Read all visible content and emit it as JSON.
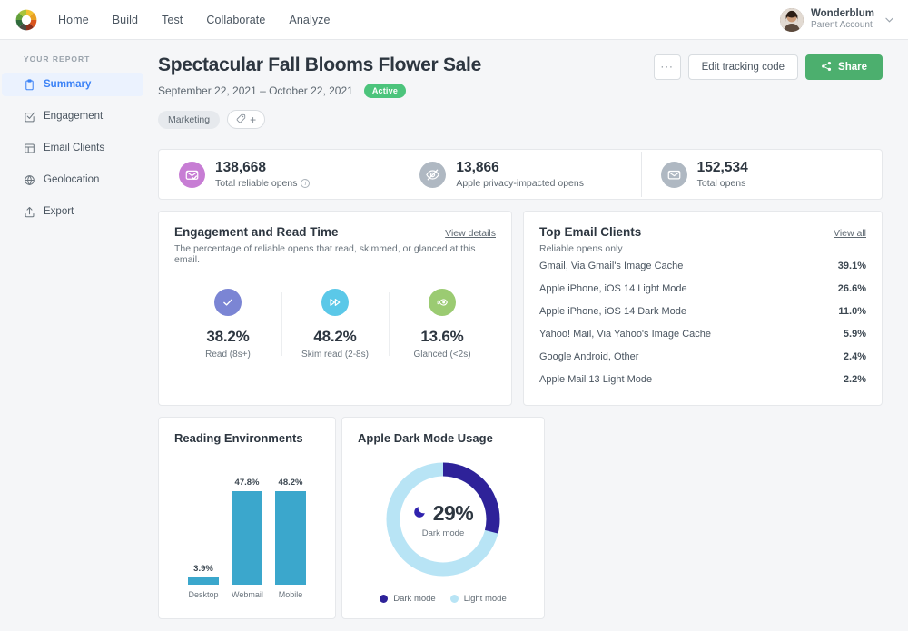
{
  "topnav": {
    "logo_icon": "color-wheel-logo",
    "links": [
      {
        "label": "Home"
      },
      {
        "label": "Build"
      },
      {
        "label": "Test"
      },
      {
        "label": "Collaborate"
      },
      {
        "label": "Analyze"
      }
    ],
    "user": {
      "name": "Wonderblum",
      "subtitle": "Parent Account",
      "avatar_icon": "user-avatar",
      "caret_icon": "chevron-down-icon"
    }
  },
  "sidebar": {
    "section_label": "YOUR REPORT",
    "items": [
      {
        "label": "Summary",
        "icon": "clipboard-icon",
        "active": true
      },
      {
        "label": "Engagement",
        "icon": "check-square-icon",
        "active": false
      },
      {
        "label": "Email Clients",
        "icon": "layout-icon",
        "active": false
      },
      {
        "label": "Geolocation",
        "icon": "globe-icon",
        "active": false
      },
      {
        "label": "Export",
        "icon": "upload-icon",
        "active": false
      }
    ]
  },
  "header": {
    "title": "Spectacular Fall Blooms Flower Sale",
    "date_range": "September 22, 2021  –   October 22, 2021",
    "status_badge": "Active",
    "tags": [
      "Marketing"
    ],
    "add_tag_icon": "tag-plus-icon",
    "add_tag_plus": "+",
    "actions": {
      "more_label": "···",
      "edit_tracking_label": "Edit tracking code",
      "share_label": "Share",
      "share_icon": "share-icon"
    }
  },
  "stats": [
    {
      "value": "138,668",
      "label": "Total reliable opens",
      "icon": "envelope-check-icon",
      "color": "#C77DD4",
      "has_info": true
    },
    {
      "value": "13,866",
      "label": "Apple privacy-impacted opens",
      "icon": "eye-off-icon",
      "color": "#AFB8C2",
      "has_info": false
    },
    {
      "value": "152,534",
      "label": "Total opens",
      "icon": "envelope-icon",
      "color": "#AFB8C2",
      "has_info": false
    }
  ],
  "engagement": {
    "title": "Engagement and Read Time",
    "subtitle": "The percentage of reliable opens that read, skimmed, or glanced at this email.",
    "link": "View details",
    "metrics": [
      {
        "value": "38.2%",
        "label": "Read (8s+)",
        "icon": "check-icon",
        "color": "#7B85D4"
      },
      {
        "value": "48.2%",
        "label": "Skim read (2-8s)",
        "icon": "fast-forward-icon",
        "color": "#5BC8E8"
      },
      {
        "value": "13.6%",
        "label": "Glanced (<2s)",
        "icon": "eye-icon",
        "color": "#9BCB72"
      }
    ]
  },
  "email_clients": {
    "title": "Top Email Clients",
    "subtitle": "Reliable opens only",
    "link": "View all",
    "rows": [
      {
        "name": "Gmail, Via Gmail's Image Cache",
        "pct": "39.1%"
      },
      {
        "name": "Apple iPhone, iOS 14 Light Mode",
        "pct": "26.6%"
      },
      {
        "name": "Apple iPhone, iOS 14 Dark Mode",
        "pct": "11.0%"
      },
      {
        "name": "Yahoo! Mail, Via Yahoo's Image Cache",
        "pct": "5.9%"
      },
      {
        "name": "Google Android, Other",
        "pct": "2.4%"
      },
      {
        "name": "Apple Mail 13 Light Mode",
        "pct": "2.2%"
      }
    ]
  },
  "chart_data": [
    {
      "type": "bar",
      "title": "Reading Environments",
      "categories": [
        "Desktop",
        "Webmail",
        "Mobile"
      ],
      "values": [
        3.9,
        47.8,
        48.2
      ],
      "value_labels": [
        "3.9%",
        "47.8%",
        "48.2%"
      ],
      "xlabel": "",
      "ylabel": "",
      "ylim": [
        0,
        55
      ],
      "grid": false,
      "legend": "none",
      "bar_color": "#3BA7CC"
    },
    {
      "type": "pie",
      "title": "Apple Dark Mode Usage",
      "categories": [
        "Dark mode",
        "Light mode"
      ],
      "values": [
        29,
        71
      ],
      "center_value": "29%",
      "center_label": "Dark mode",
      "center_icon": "moon-icon",
      "legend": "bottom",
      "legend_entries": [
        "Dark mode",
        "Light mode"
      ],
      "colors": [
        "#2E2299",
        "#B8E4F5"
      ]
    }
  ]
}
